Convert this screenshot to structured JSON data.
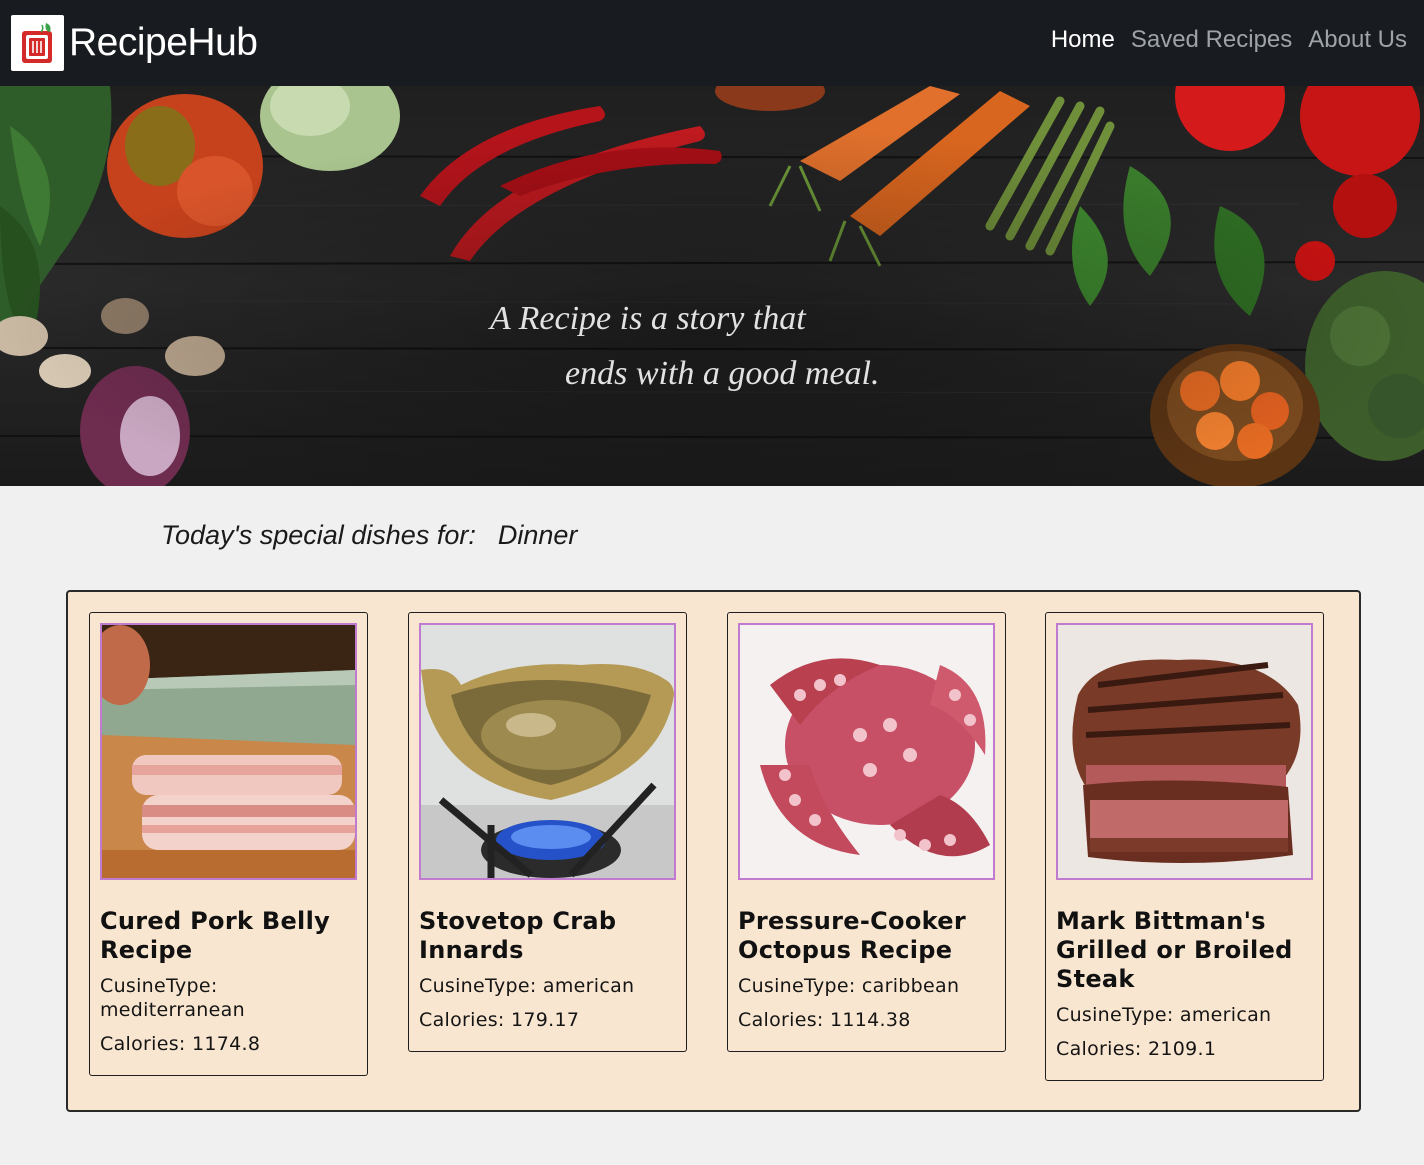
{
  "nav": {
    "brand": "RecipeHub",
    "links": [
      {
        "label": "Home",
        "active": true
      },
      {
        "label": "Saved Recipes",
        "active": false
      },
      {
        "label": "About Us",
        "active": false
      }
    ]
  },
  "hero": {
    "quote_line1": "A Recipe is a story that",
    "quote_line2": "ends with a good meal."
  },
  "today": {
    "prefix": "Today's special dishes for:",
    "meal": "Dinner"
  },
  "recipes": [
    {
      "title": "Cured Pork Belly Recipe",
      "cuisine_label": "CusineType:",
      "cuisine": "mediterranean",
      "calories_label": "Calories:",
      "calories": "1174.8",
      "image": "pork-belly-photo"
    },
    {
      "title": "Stovetop Crab Innards",
      "cuisine_label": "CusineType:",
      "cuisine": "american",
      "calories_label": "Calories:",
      "calories": "179.17",
      "image": "crab-photo"
    },
    {
      "title": "Pressure-Cooker Octopus Recipe",
      "cuisine_label": "CusineType:",
      "cuisine": "caribbean",
      "calories_label": "Calories:",
      "calories": "1114.38",
      "image": "octopus-photo"
    },
    {
      "title": "Mark Bittman's Grilled or Broiled Steak",
      "cuisine_label": "CusineType:",
      "cuisine": "american",
      "calories_label": "Calories:",
      "calories": "2109.1",
      "image": "steak-photo"
    }
  ],
  "colors": {
    "navbar": "#181c20",
    "page_bg": "#f0f0f0",
    "panel_bg": "#f9e6d0",
    "image_border": "#c07ad0"
  }
}
